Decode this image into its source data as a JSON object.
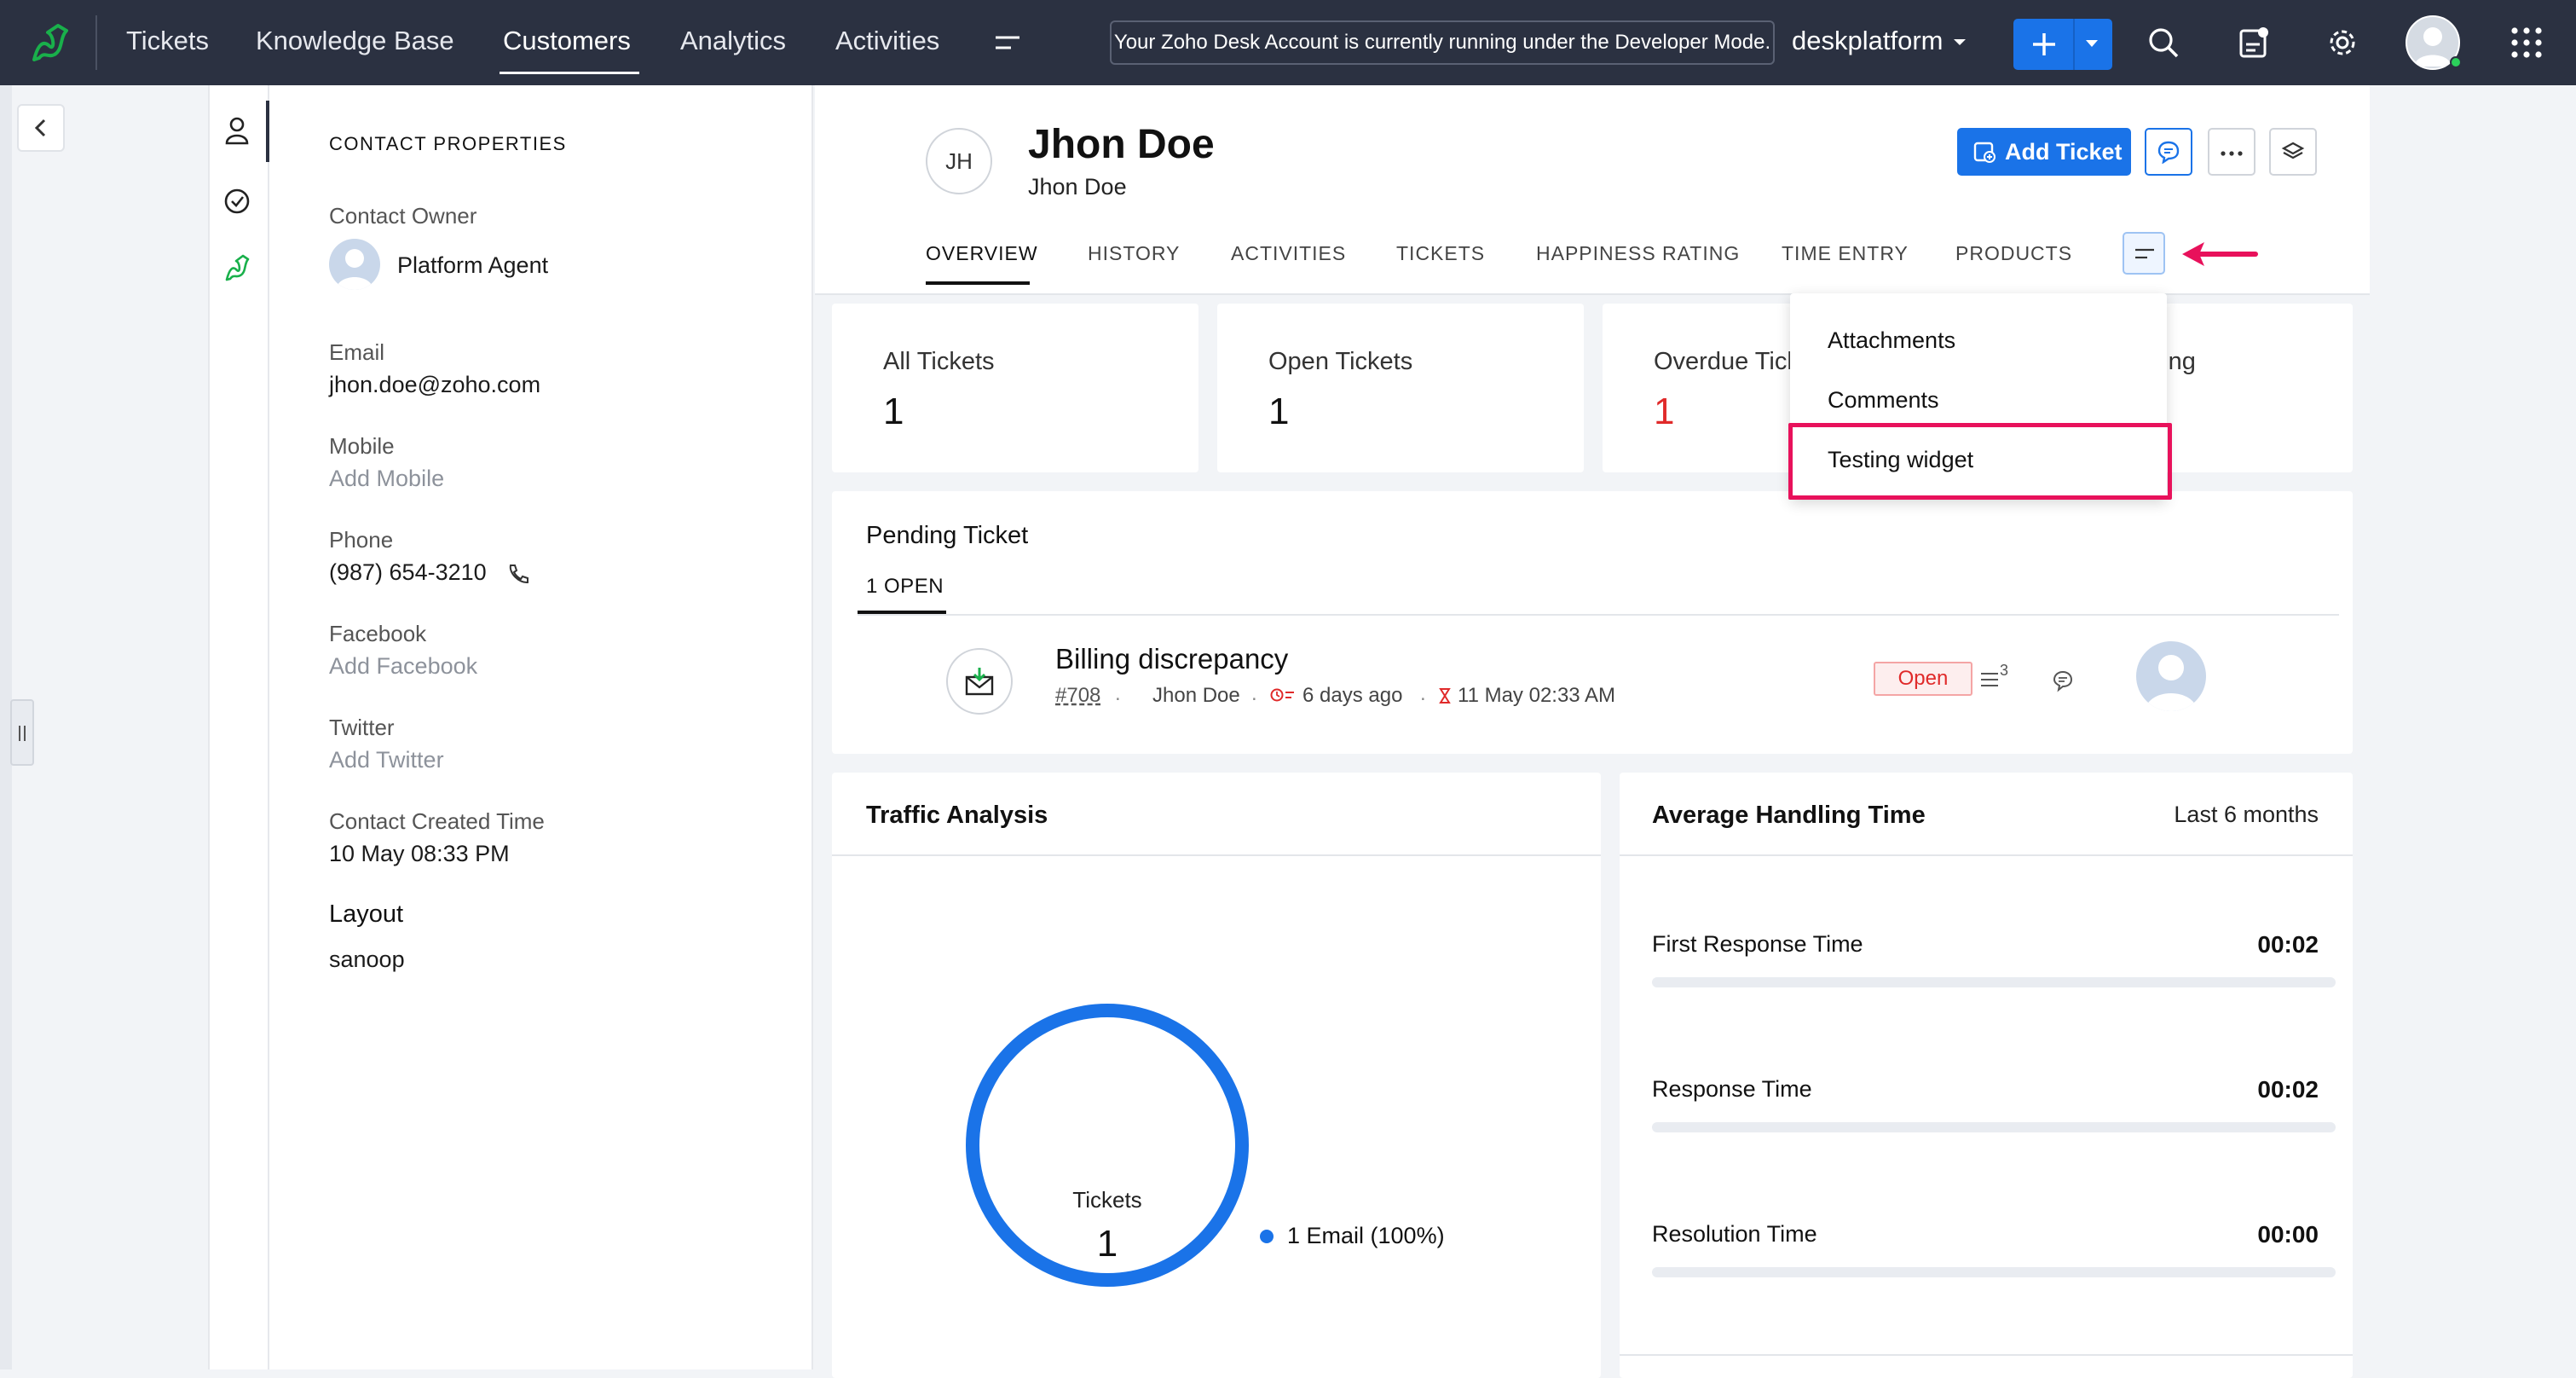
{
  "nav": {
    "items": [
      "Tickets",
      "Knowledge Base",
      "Customers",
      "Analytics",
      "Activities"
    ],
    "dev_banner": "Your Zoho Desk Account is currently running under the Developer Mode.",
    "org_name": "deskplatform",
    "accent": "#1a73e8"
  },
  "contact_properties": {
    "heading": "CONTACT PROPERTIES",
    "owner_label": "Contact Owner",
    "owner_name": "Platform Agent",
    "email_label": "Email",
    "email": "jhon.doe@zoho.com",
    "mobile_label": "Mobile",
    "mobile": "Add Mobile",
    "phone_label": "Phone",
    "phone": "(987) 654-3210",
    "facebook_label": "Facebook",
    "facebook": "Add Facebook",
    "twitter_label": "Twitter",
    "twitter": "Add Twitter",
    "created_label": "Contact Created Time",
    "created": "10 May 08:33 PM",
    "layout_label": "Layout",
    "layout": "sanoop"
  },
  "contact": {
    "initials": "JH",
    "name": "Jhon Doe",
    "subname": "Jhon Doe",
    "add_ticket": "Add Ticket"
  },
  "tabs": [
    "OVERVIEW",
    "HISTORY",
    "ACTIVITIES",
    "TICKETS",
    "HAPPINESS RATING",
    "TIME ENTRY",
    "PRODUCTS"
  ],
  "stats": {
    "all_tickets_label": "All Tickets",
    "all_tickets": "1",
    "open_tickets_label": "Open Tickets",
    "open_tickets": "1",
    "overdue_label": "Overdue Tickets",
    "overdue": "1",
    "rating_label": "Rating"
  },
  "dropdown": {
    "items": [
      "Attachments",
      "Comments",
      "Testing widget"
    ],
    "highlight_color": "#e8115b"
  },
  "pending": {
    "title": "Pending Ticket",
    "tab": "1 OPEN",
    "ticket": {
      "subject": "Billing discrepancy",
      "number": "#708",
      "contact": "Jhon Doe",
      "age": "6 days ago",
      "due": "11 May 02:33 AM",
      "status": "Open",
      "thread_count": "3"
    }
  },
  "traffic": {
    "title": "Traffic Analysis",
    "center_label": "Tickets",
    "center_value": "1",
    "legend": "1 Email (100%)"
  },
  "handling": {
    "title": "Average Handling Time",
    "period": "Last 6 months",
    "rows": [
      {
        "label": "First Response Time",
        "value": "00:02"
      },
      {
        "label": "Response Time",
        "value": "00:02"
      },
      {
        "label": "Resolution Time",
        "value": "00:00"
      }
    ]
  }
}
